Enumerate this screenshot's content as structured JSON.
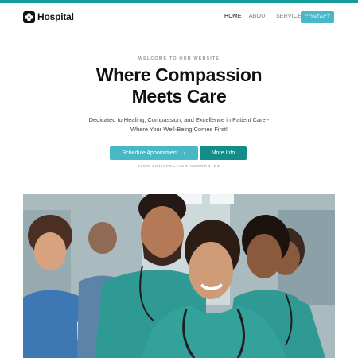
{
  "brand": {
    "name": "Hospital",
    "icon": "medical-cross-icon"
  },
  "nav": {
    "items": [
      {
        "label": "HOME",
        "active": true
      },
      {
        "label": "ABOUT",
        "active": false
      },
      {
        "label": "SERVICES",
        "active": false
      }
    ],
    "contact_label": "CONTACT"
  },
  "hero": {
    "eyebrow": "WELCOME TO OUR WEBSITE",
    "title_line1": "Where Compassion",
    "title_line2": "Meets Care",
    "subtitle_line1": "Dedicated to Healing, Compassion, and Excellence in Patient Care -",
    "subtitle_line2": "Where Your Well-Being Comes First!",
    "primary_button": "Schedule Appointment",
    "secondary_button": "More Info",
    "guarantee": "100% SATISFACTION GUARANTEE"
  },
  "colors": {
    "accent_bar": "#159c9a",
    "primary_button": "#48b8c6",
    "secondary_button": "#128d89",
    "scrubs": "#2f9a93"
  },
  "image": {
    "subject": "medical-staff-photo"
  }
}
